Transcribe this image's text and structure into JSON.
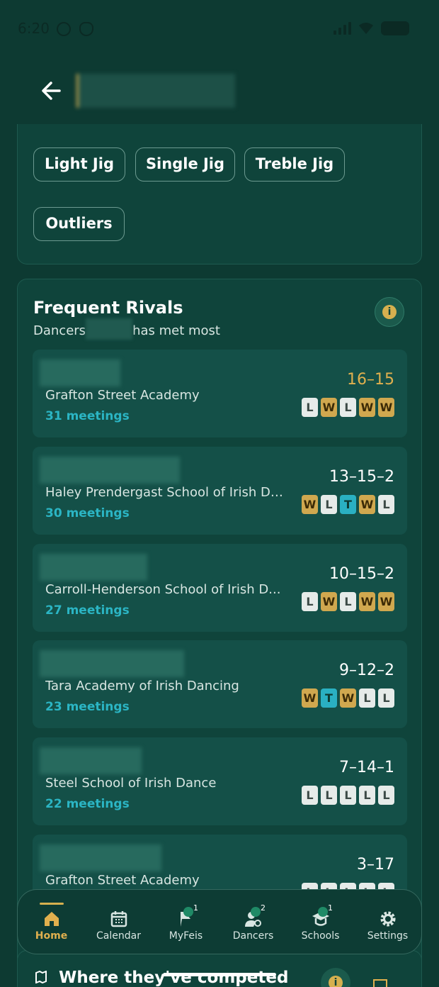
{
  "status_bar": {
    "time": "6:20"
  },
  "dance_chips": [
    {
      "label": "Light Jig"
    },
    {
      "label": "Single Jig"
    },
    {
      "label": "Treble Jig"
    },
    {
      "label": "Outliers"
    }
  ],
  "rivals": {
    "title": "Frequent Rivals",
    "subtitle_prefix": "Dancers",
    "subtitle_suffix": "has met most",
    "items": [
      {
        "school": "Grafton Street Academy",
        "meetings": "31 meetings",
        "record": "16–15",
        "record_highlight": true,
        "form": [
          "L",
          "W",
          "L",
          "W",
          "W"
        ]
      },
      {
        "school": "Haley Prendergast School of Irish Da...",
        "meetings": "30 meetings",
        "record": "13–15–2",
        "record_highlight": false,
        "form": [
          "W",
          "L",
          "T",
          "W",
          "L"
        ]
      },
      {
        "school": "Carroll-Henderson School of Irish D...",
        "meetings": "27 meetings",
        "record": "10–15–2",
        "record_highlight": false,
        "form": [
          "L",
          "W",
          "L",
          "W",
          "W"
        ]
      },
      {
        "school": "Tara Academy of Irish Dancing",
        "meetings": "23 meetings",
        "record": "9–12–2",
        "record_highlight": false,
        "form": [
          "W",
          "T",
          "W",
          "L",
          "L"
        ]
      },
      {
        "school": "Steel School of Irish Dance",
        "meetings": "22 meetings",
        "record": "7–14–1",
        "record_highlight": false,
        "form": [
          "L",
          "L",
          "L",
          "L",
          "L"
        ]
      },
      {
        "school": "Grafton Street Academy",
        "meetings": "",
        "record": "3–17",
        "record_highlight": false,
        "form": [
          "L",
          "L",
          "L",
          "L",
          "L"
        ]
      }
    ]
  },
  "bottom_nav": [
    {
      "label": "Home",
      "active": true,
      "badge": ""
    },
    {
      "label": "Calendar",
      "active": false,
      "badge": ""
    },
    {
      "label": "MyFeis",
      "active": false,
      "badge": "1"
    },
    {
      "label": "Dancers",
      "active": false,
      "badge": "2"
    },
    {
      "label": "Schools",
      "active": false,
      "badge": "1"
    },
    {
      "label": "Settings",
      "active": false,
      "badge": ""
    }
  ],
  "next_section": {
    "title": "Where they've competed"
  },
  "colors": {
    "background": "#0d3a32",
    "accent_gold": "#e0b04e",
    "accent_teal": "#2bb5c4"
  }
}
